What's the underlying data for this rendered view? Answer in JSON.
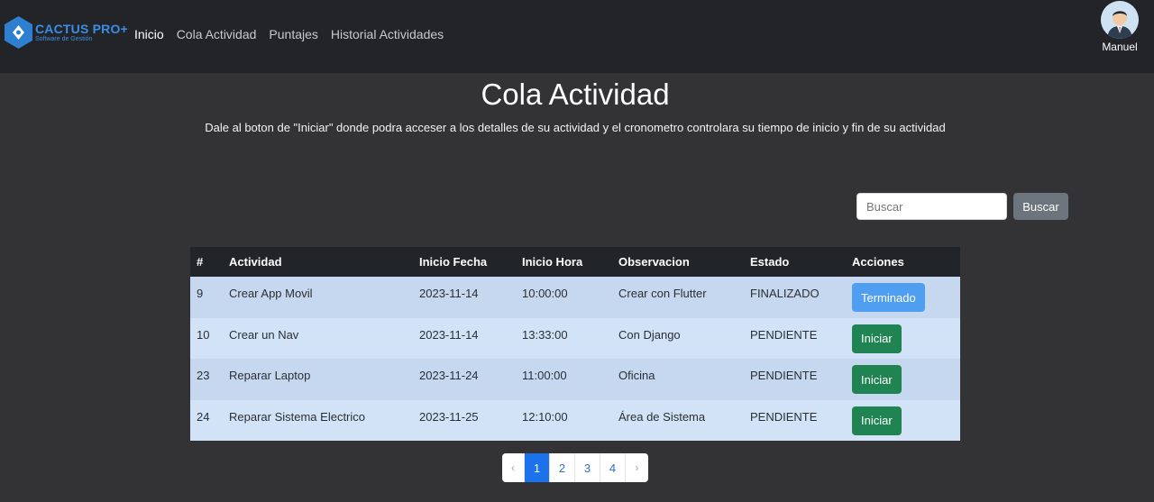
{
  "brand": {
    "name": "CACTUS PRO+",
    "subtitle": "Software de Gestión"
  },
  "nav": {
    "links": [
      "Inicio",
      "Cola Actividad",
      "Puntajes",
      "Historial Actividades"
    ],
    "active_index": 0
  },
  "user": {
    "name": "Manuel"
  },
  "page": {
    "title": "Cola Actividad",
    "subtitle": "Dale al boton de \"Iniciar\" donde podra acceser a los detalles de su actividad y el cronometro controlara su tiempo de inicio y fin de su actividad"
  },
  "search": {
    "placeholder": "Buscar",
    "value": "",
    "button_label": "Buscar"
  },
  "table": {
    "headers": [
      "#",
      "Actividad",
      "Inicio Fecha",
      "Inicio Hora",
      "Observacion",
      "Estado",
      "Acciones"
    ],
    "rows": [
      {
        "id": "9",
        "actividad": "Crear App Movil",
        "fecha": "2023-11-14",
        "hora": "10:00:00",
        "observacion": "Crear con Flutter",
        "estado": "FINALIZADO",
        "accion": "Terminado"
      },
      {
        "id": "10",
        "actividad": "Crear un Nav",
        "fecha": "2023-11-14",
        "hora": "13:33:00",
        "observacion": "Con Django",
        "estado": "PENDIENTE",
        "accion": "Iniciar"
      },
      {
        "id": "23",
        "actividad": "Reparar Laptop",
        "fecha": "2023-11-24",
        "hora": "11:00:00",
        "observacion": "Oficina",
        "estado": "PENDIENTE",
        "accion": "Iniciar"
      },
      {
        "id": "24",
        "actividad": "Reparar Sistema Electrico",
        "fecha": "2023-11-25",
        "hora": "12:10:00",
        "observacion": "Área de Sistema",
        "estado": "PENDIENTE",
        "accion": "Iniciar"
      }
    ]
  },
  "pagination": {
    "prev": "‹",
    "pages": [
      "1",
      "2",
      "3",
      "4"
    ],
    "next": "›",
    "current": "1"
  },
  "colors": {
    "brand": "#3a8ee6",
    "navbar_bg": "#232427",
    "page_bg": "#333335",
    "header_bg": "#212529",
    "btn_terminado": "#4f9ef0",
    "btn_iniciar": "#1f8452",
    "btn_buscar": "#6c757d",
    "page_active": "#1b72ea"
  },
  "icons": {
    "brand": "cactus-hexagon-logo",
    "avatar": "user-avatar"
  }
}
